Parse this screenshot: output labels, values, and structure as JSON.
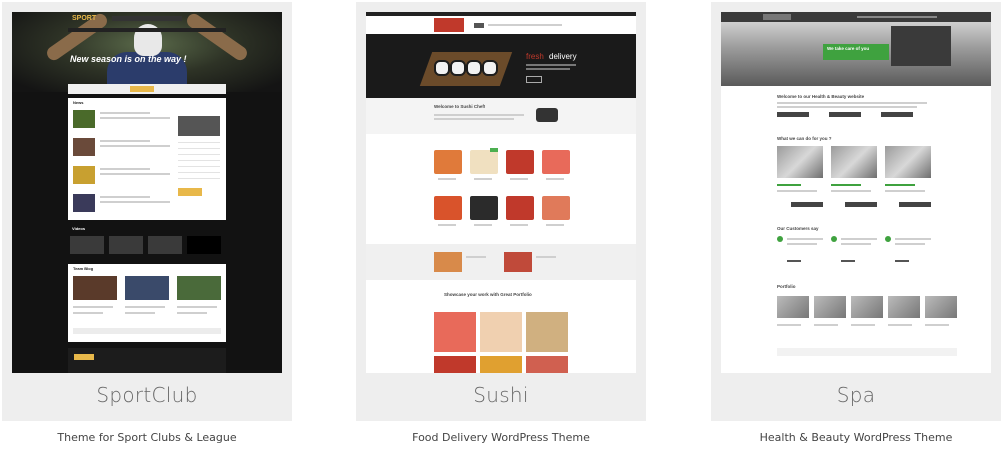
{
  "themes": [
    {
      "title": "SportClub",
      "tagline": "Theme for Sport Clubs & League",
      "preview": {
        "logo": "SPORT",
        "hero_text": "New season is on the way !",
        "section_news": "News",
        "section_videos": "Videos",
        "section_blog": "Team Blog"
      }
    },
    {
      "title": "Sushi",
      "tagline": "Food Delivery WordPress Theme",
      "preview": {
        "hero_text_1": "fresh",
        "hero_text_2": "delivery",
        "welcome": "Welcome to Sushi Chef!",
        "portfolio": "Showcase your work with Great Portfolio"
      }
    },
    {
      "title": "Spa",
      "tagline": "Health & Beauty WordPress Theme",
      "preview": {
        "hero_badge": "We take care of you",
        "welcome": "Welcome to our Health & Beauty website",
        "services": "What we can do for you ?",
        "testimonials": "Our Customers say",
        "portfolio": "Portfolio"
      }
    }
  ],
  "colors": {
    "card_bg": "#eeeeee",
    "spa_accent": "#3fa23f",
    "sushi_accent": "#c0392b",
    "sport_accent": "#e8b84a"
  }
}
